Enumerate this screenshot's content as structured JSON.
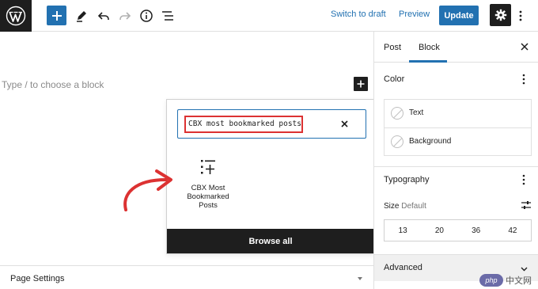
{
  "toolbar": {
    "switch_to_draft": "Switch to draft",
    "preview": "Preview",
    "update": "Update"
  },
  "editor": {
    "placeholder": "Type / to choose a block"
  },
  "inserter": {
    "search_value": "CBX most bookmarked posts",
    "result_label": "CBX Most\nBookmarked\nPosts",
    "result_icon": "list-plus-icon",
    "browse_all": "Browse all"
  },
  "page_settings": {
    "label": "Page Settings"
  },
  "sidebar": {
    "tabs": [
      "Post",
      "Block"
    ],
    "active_tab": "Block",
    "color": {
      "title": "Color",
      "items": [
        "Text",
        "Background"
      ]
    },
    "typography": {
      "title": "Typography",
      "size_label": "Size",
      "size_default": "Default",
      "sizes": [
        "13",
        "20",
        "36",
        "42"
      ]
    },
    "advanced": "Advanced"
  },
  "watermark": {
    "badge": "php",
    "text": "中文网"
  },
  "colors": {
    "accent": "#2271b1",
    "dark": "#1e1e1e",
    "annotation": "#dc3232"
  }
}
